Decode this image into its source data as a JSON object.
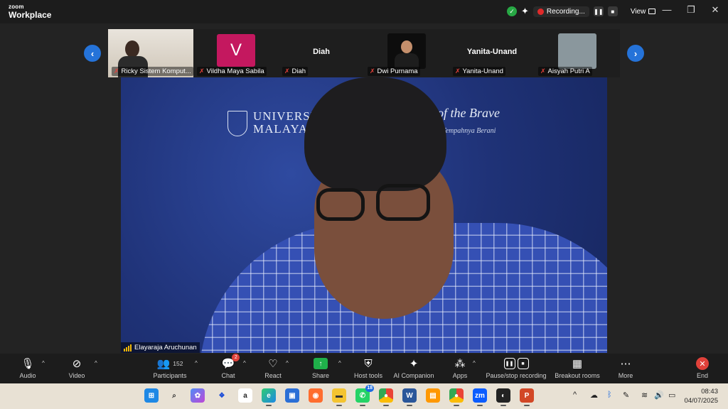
{
  "window": {
    "brand_top": "zoom",
    "brand_bottom": "Workplace",
    "recording_label": "Recording...",
    "view_label": "View"
  },
  "participants_strip": [
    {
      "name": "Ricky Sistem Komput...",
      "display": "photo"
    },
    {
      "name": "Vildha Maya Sabila",
      "display": "letter",
      "letter": "V",
      "color": "#c4185f"
    },
    {
      "name": "Diah",
      "display": "name",
      "title": "Diah"
    },
    {
      "name": "Dwi Purnama",
      "display": "photo"
    },
    {
      "name": "Yanita-Unand",
      "display": "name",
      "title": "Yanita-Unand"
    },
    {
      "name": "Aisyah Putri A",
      "display": "photo"
    }
  ],
  "main_video": {
    "speaker_name": "Elayaraja Aruchunan",
    "backdrop_line1": "UNIVERSITI",
    "backdrop_line2": "MALAYA",
    "backdrop_tagline": "of the Brave",
    "backdrop_tagline2": "Tempahnya Berani"
  },
  "toolbar": {
    "audio": "Audio",
    "video": "Video",
    "participants": "Participants",
    "participants_count": "152",
    "chat": "Chat",
    "chat_badge": "2",
    "react": "React",
    "share": "Share",
    "host_tools": "Host tools",
    "ai_companion": "AI Companion",
    "apps": "Apps",
    "pause_recording": "Pause/stop recording",
    "breakout_rooms": "Breakout rooms",
    "more": "More",
    "end": "End"
  },
  "taskbar": {
    "whatsapp_badge": "18",
    "time": "08:43",
    "date": "04/07/2025"
  },
  "colors": {
    "accent_blue": "#2573d9",
    "share_green": "#1fb04a",
    "end_red": "#e0413a",
    "recording_red": "#e02a2a"
  }
}
